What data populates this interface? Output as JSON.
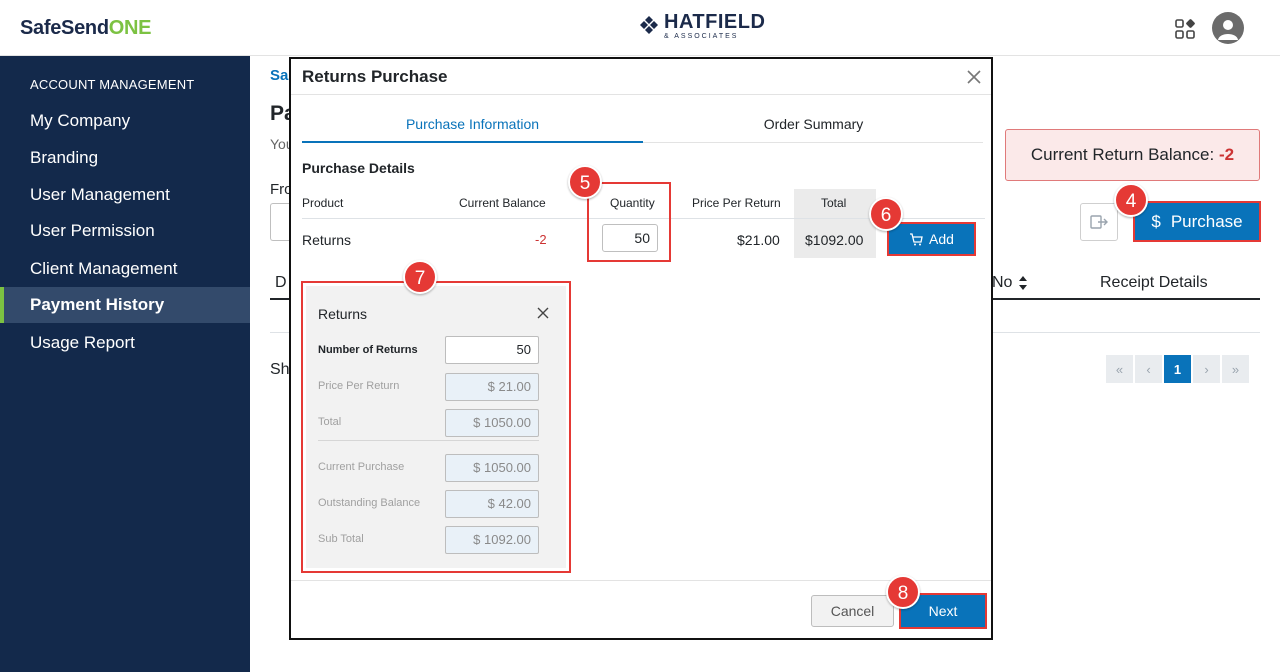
{
  "header": {
    "logo_main": "SafeSend",
    "logo_accent": "ONE",
    "brand_name": "HATFIELD",
    "brand_sub": "& ASSOCIATES"
  },
  "sidebar": {
    "section_title": "ACCOUNT MANAGEMENT",
    "items": [
      {
        "label": "My Company"
      },
      {
        "label": "Branding"
      },
      {
        "label": "User Management"
      },
      {
        "label": "User Permission"
      },
      {
        "label": "Client Management"
      },
      {
        "label": "Payment History",
        "active": true
      },
      {
        "label": "Usage Report"
      }
    ]
  },
  "background": {
    "breadcrumb_frag": "Sa",
    "title_frag": "Pa",
    "subtitle_frag": "You",
    "from_frag": "Fro",
    "col_frag": "D",
    "show_frag": "Sh",
    "balance_label": "Current Return Balance:",
    "balance_value": "-2",
    "purchase_label": "Purchase",
    "purchase_symbol": "$",
    "col_no": "No",
    "col_receipt": "Receipt Details",
    "pagination": {
      "current": "1"
    }
  },
  "modal": {
    "title": "Returns Purchase",
    "tabs": [
      {
        "label": "Purchase Information",
        "active": true
      },
      {
        "label": "Order Summary"
      }
    ],
    "section_title": "Purchase Details",
    "columns": {
      "product": "Product",
      "current_balance": "Current Balance",
      "quantity": "Quantity",
      "price": "Price Per Return",
      "total": "Total"
    },
    "row": {
      "product": "Returns",
      "current_balance": "-2",
      "quantity": "50",
      "price": "$21.00",
      "total": "$1092.00"
    },
    "add_label": "Add",
    "returns_panel": {
      "title": "Returns",
      "fields": [
        {
          "label": "Number of Returns",
          "value": "50"
        },
        {
          "label": "Price Per Return",
          "value": "$ 21.00"
        },
        {
          "label": "Total",
          "value": "$ 1050.00"
        },
        {
          "label": "Current Purchase",
          "value": "$ 1050.00"
        },
        {
          "label": "Outstanding Balance",
          "value": "$ 42.00"
        },
        {
          "label": "Sub Total",
          "value": "$ 1092.00"
        }
      ]
    },
    "cancel_label": "Cancel",
    "next_label": "Next"
  },
  "steps": [
    "4",
    "5",
    "6",
    "7",
    "8"
  ],
  "colors": {
    "sidebar_bg": "#13294b",
    "accent_green": "#7cc242",
    "primary_blue": "#0973ba",
    "highlight_red": "#e53935"
  }
}
